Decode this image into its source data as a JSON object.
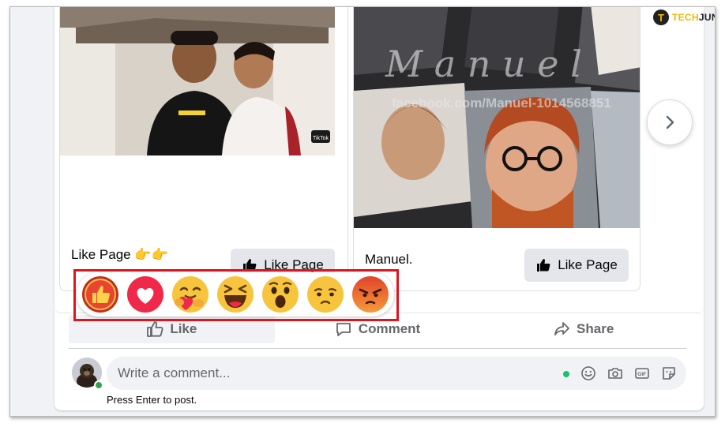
{
  "watermark": {
    "part1": "TECH",
    "part2": "JUNKIE",
    "badge": "T"
  },
  "carousel": {
    "cards": [
      {
        "title": "Like Page",
        "emoji": "👉👉",
        "button_label": "Like Page"
      },
      {
        "title": "Manuel.",
        "button_label": "Like Page",
        "image_overlay_script": "M a n u e l",
        "image_overlay_url": "facebook.com/Manuel-1014568851"
      }
    ],
    "card1_image_badge": "TikTok",
    "next_icon": "chevron-right-icon"
  },
  "reactions": [
    {
      "name": "Like",
      "icon": "like-reaction-icon"
    },
    {
      "name": "Love",
      "icon": "love-reaction-icon"
    },
    {
      "name": "Care",
      "icon": "care-reaction-icon"
    },
    {
      "name": "Haha",
      "icon": "haha-reaction-icon"
    },
    {
      "name": "Wow",
      "icon": "wow-reaction-icon"
    },
    {
      "name": "Sad",
      "icon": "sad-reaction-icon"
    },
    {
      "name": "Angry",
      "icon": "angry-reaction-icon"
    }
  ],
  "actions": {
    "like": "Like",
    "comment": "Comment",
    "share": "Share"
  },
  "comment": {
    "placeholder": "Write a comment...",
    "hint": "Press Enter to post.",
    "icons": [
      "emoji-icon",
      "camera-icon",
      "gif-icon",
      "sticker-icon"
    ]
  },
  "colors": {
    "highlight": "#e0141e",
    "facebook_gray": "#65676b",
    "online_green": "#31a24c"
  }
}
